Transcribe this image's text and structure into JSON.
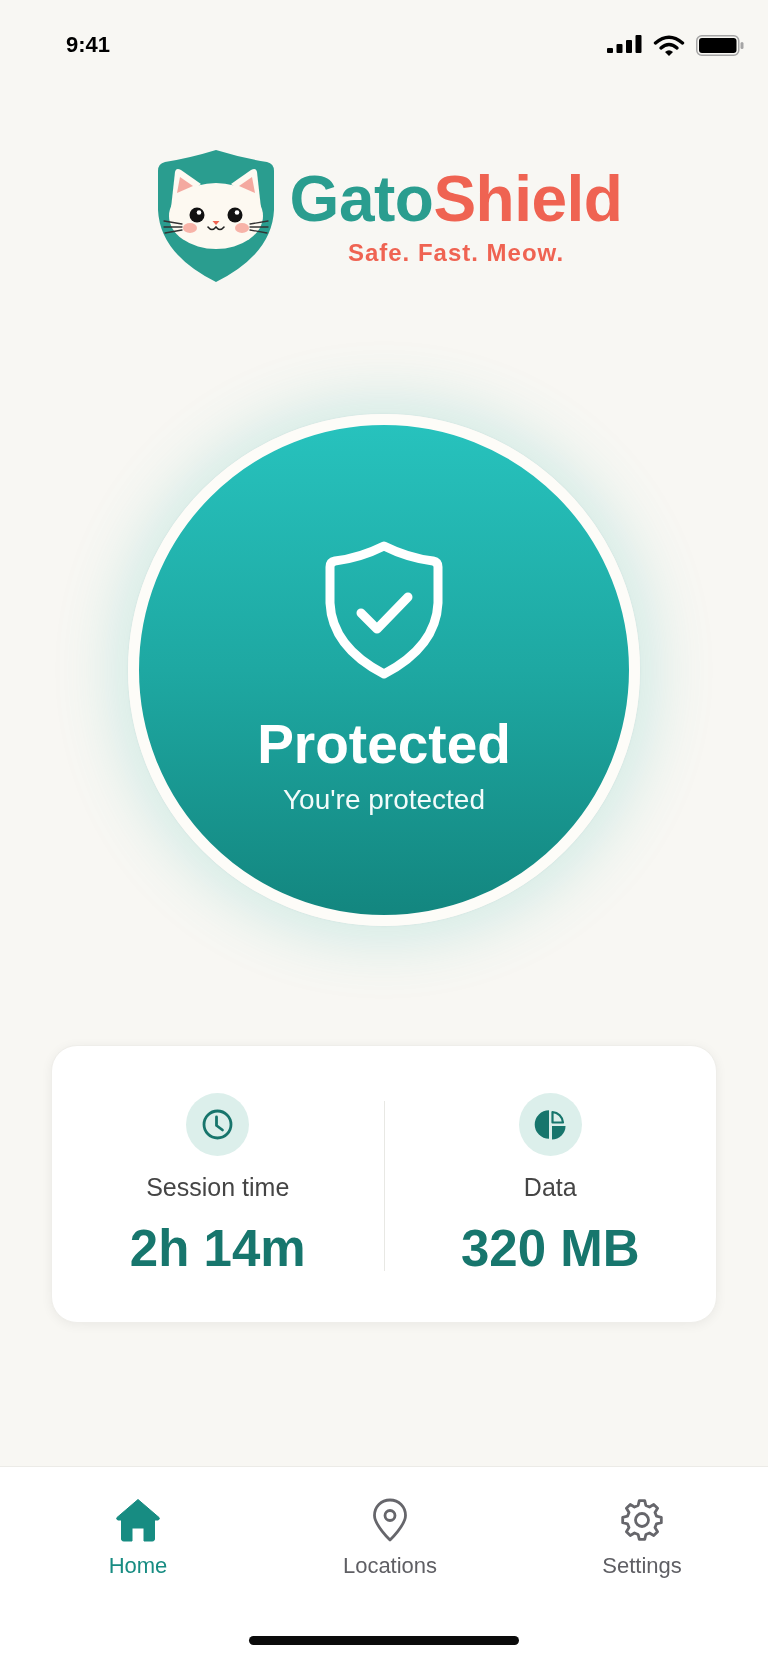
{
  "status_bar": {
    "time": "9:41"
  },
  "brand": {
    "name_parts": [
      {
        "text": "Gato",
        "color": "#2a9d8f"
      },
      {
        "text": "Shield",
        "color": "#ef6352"
      }
    ],
    "tagline": "Safe. Fast. Meow."
  },
  "connection": {
    "on": true,
    "title": "Protected",
    "subtitle": "You're protected"
  },
  "stats": [
    {
      "kind": "time",
      "label": "Session time",
      "value": "2h 14m"
    },
    {
      "kind": "data",
      "label": "Data",
      "value": "320 MB"
    }
  ],
  "nav": [
    {
      "kind": "home",
      "label": "Home",
      "selected": true
    },
    {
      "kind": "locations",
      "label": "Locations",
      "selected": false
    },
    {
      "kind": "settings",
      "label": "Settings",
      "selected": false
    }
  ]
}
